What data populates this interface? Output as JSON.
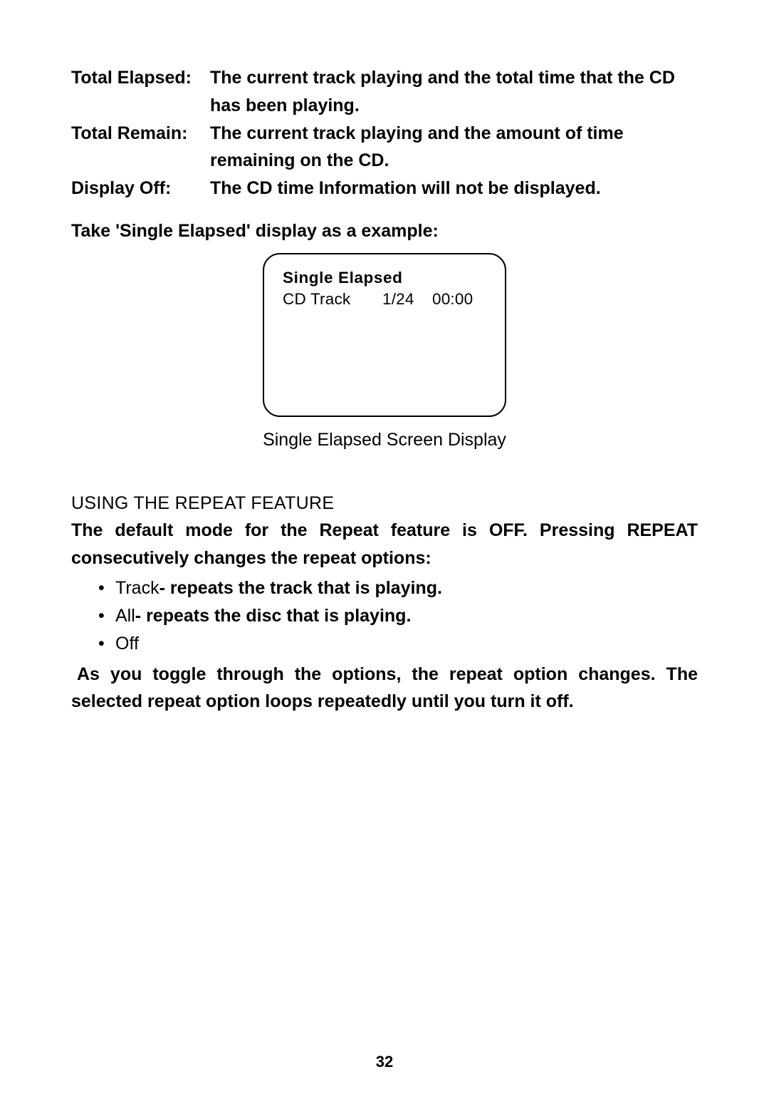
{
  "definitions": {
    "item1_term": "Total Elapsed:",
    "item1_desc": "The current  track playing and the total time that the CD has been playing.",
    "item2_term": "Total Remain:",
    "item2_desc": "The current track playing and  the amount of time remaining on the CD.",
    "item3_term": "Display Off:",
    "item3_desc": "The CD time Information will not be displayed."
  },
  "example_intro": "Take 'Single Elapsed' display as a example:",
  "display": {
    "line1": "Single Elapsed",
    "line2_label": "CD Track",
    "line2_num": "1/24",
    "line2_time": "00:00"
  },
  "caption": "Single Elapsed Screen Display",
  "section_title": "USING THE REPEAT FEATURE",
  "para1": "The default mode for the Repeat feature is OFF. Pressing  REPEAT consecutively  changes the repeat options:",
  "bullets": {
    "b1_prefix": "Track",
    "b1_rest": "- repeats the track that is playing.",
    "b2_prefix": "All",
    "b2_rest": "- repeats the disc that is playing.",
    "b3": "Off"
  },
  "para2": "As you toggle through the options, the repeat option changes.  The selected repeat option loops repeatedly until you turn it off.",
  "page_number": "32"
}
